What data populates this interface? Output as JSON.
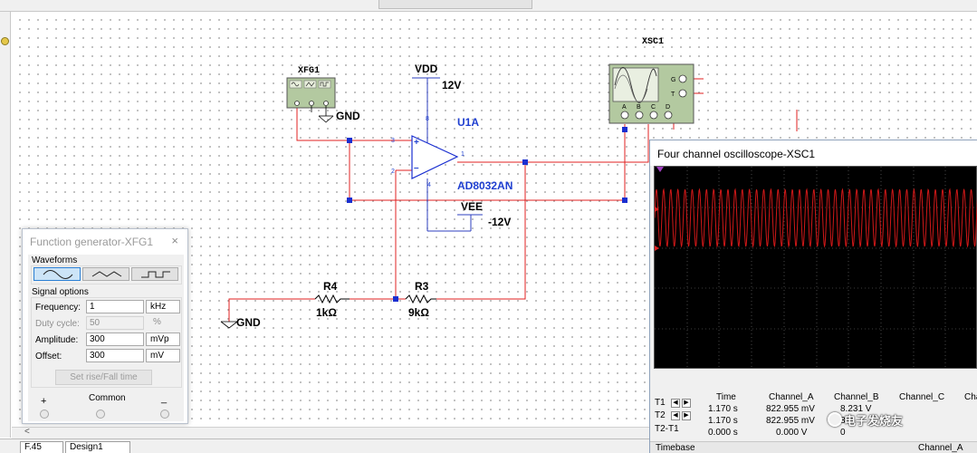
{
  "schematic": {
    "xfg1_label": "XFG1",
    "gnd_label_1": "GND",
    "gnd_label_2": "GND",
    "vdd_label": "VDD",
    "vdd_value": "12V",
    "vee_label": "VEE",
    "vee_value": "-12V",
    "opamp_ref": "U1A",
    "opamp_model": "AD8032AN",
    "pin_labels": [
      "8",
      "3",
      "1",
      "2",
      "4"
    ],
    "r4_label": "R4",
    "r4_value": "1kΩ",
    "r3_label": "R3",
    "r3_value": "9kΩ",
    "xsc1_label": "XSC1",
    "scope_terminals": [
      "A",
      "B",
      "C",
      "D"
    ],
    "scope_side_terminals": [
      "G",
      "T"
    ]
  },
  "function_generator": {
    "title": "Function generator-XFG1",
    "close_icon": "×",
    "waveforms_label": "Waveforms",
    "waveforms": [
      "sine-wave-icon",
      "triangle-wave-icon",
      "square-wave-icon"
    ],
    "selected_waveform": "sine-wave-icon",
    "signal_options_label": "Signal options",
    "frequency_label": "Frequency:",
    "frequency_value": "1",
    "frequency_unit": "kHz",
    "duty_cycle_label": "Duty cycle:",
    "duty_cycle_value": "50",
    "duty_cycle_unit": "%",
    "amplitude_label": "Amplitude:",
    "amplitude_value": "300",
    "amplitude_unit": "mVp",
    "offset_label": "Offset:",
    "offset_value": "300",
    "offset_unit": "mV",
    "set_rise_fall_label": "Set rise/Fall time",
    "plus_label": "+",
    "common_label": "Common",
    "minus_label": "_"
  },
  "oscilloscope": {
    "title": "Four channel oscilloscope-XSC1",
    "trace_color": "#d01818",
    "cursor_t1": "T1",
    "cursor_t2": "T2",
    "cursor_t2t1": "T2-T1",
    "columns": [
      "Time",
      "Channel_A",
      "Channel_B",
      "Channel_C",
      "Cha"
    ],
    "rows": [
      [
        "1.170 s",
        "822.955 mV",
        "8.231 V"
      ],
      [
        "1.170 s",
        "822.955 mV",
        "8.2"
      ],
      [
        "0.000 s",
        "0.000 V",
        "0"
      ]
    ],
    "timebase_label": "Timebase",
    "channel_a_label": "Channel_A"
  },
  "bottom_tabs": [
    "F.45",
    "Design1"
  ],
  "watermark": "电子发烧友"
}
